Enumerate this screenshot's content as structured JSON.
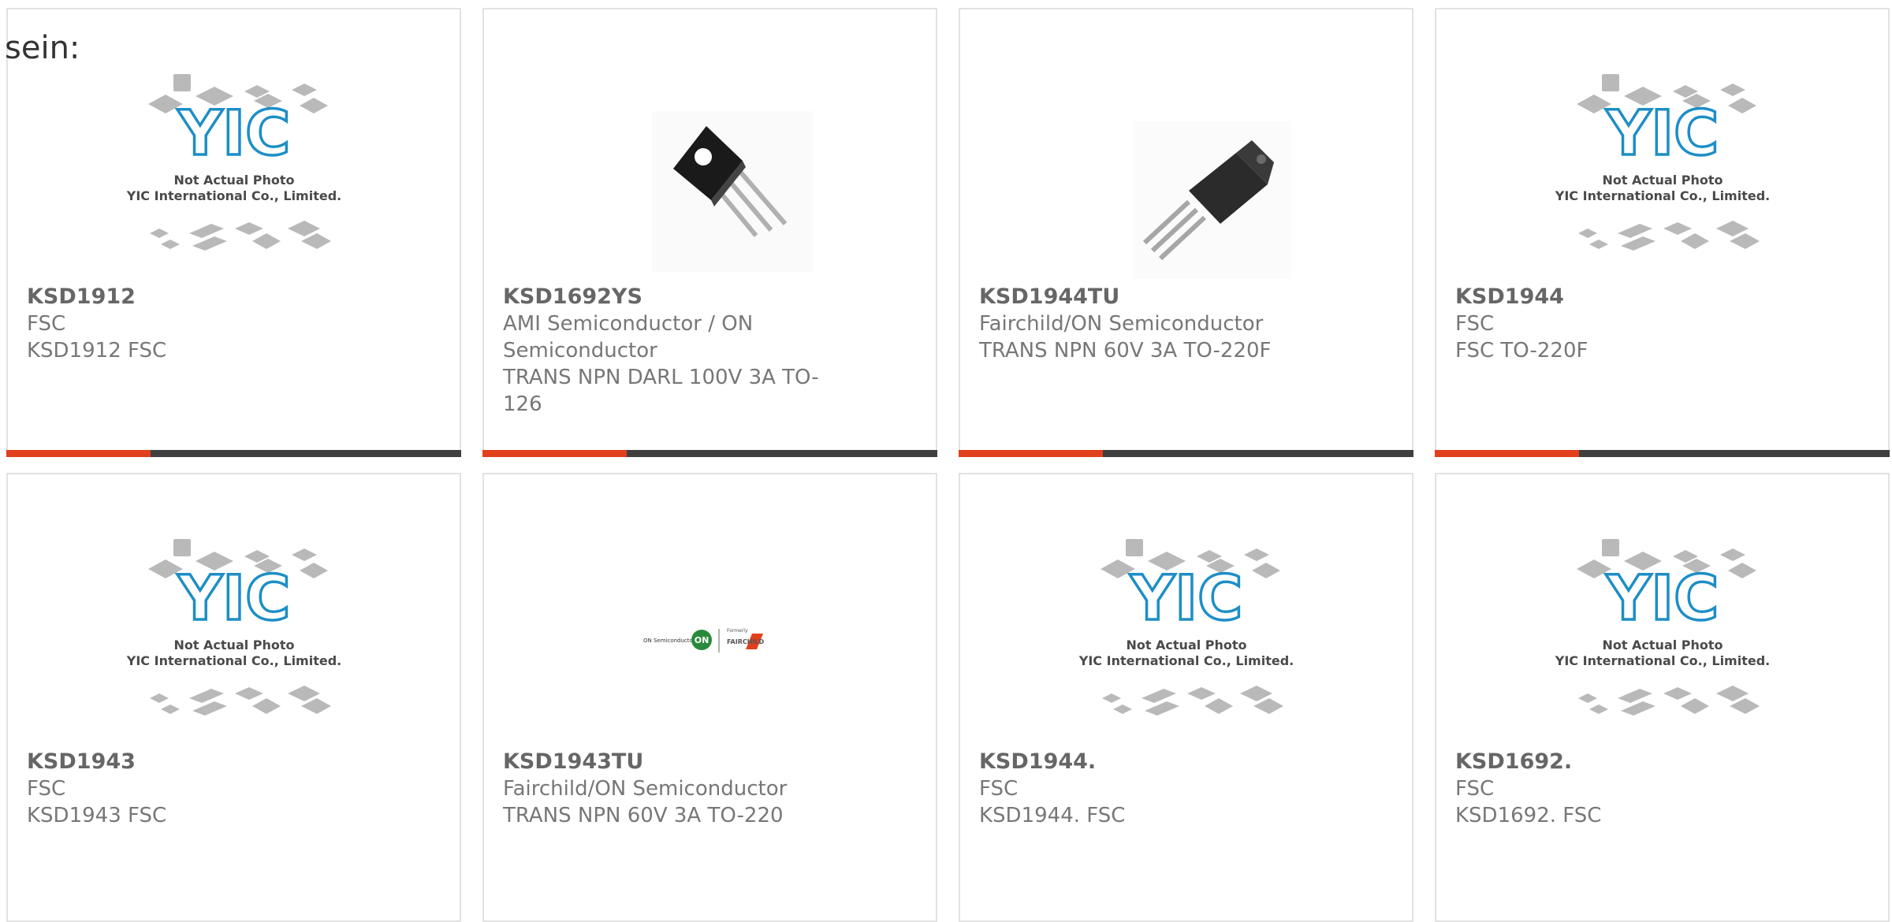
{
  "intro_text": "sein:",
  "placeholder_image": {
    "caption_line1": "Not Actual Photo",
    "caption_line2": "YIC International Co., Limited.",
    "logo_text": "YIC",
    "logo_color": "#1d8ec7"
  },
  "brand_logos": {
    "on_semi_text": "ON Semiconductor",
    "on_mark": "ON",
    "formerly_text": "Formerly",
    "fairchild_text": "FAIRCHILD"
  },
  "colors": {
    "accent_bar": "#e2401c",
    "dark_bar": "#3f3f3f",
    "card_border": "#e2e2e2"
  },
  "products": [
    {
      "part": "KSD1912",
      "manufacturer": "FSC",
      "description": "KSD1912 FSC",
      "image": "yic-placeholder",
      "bar": true
    },
    {
      "part": "KSD1692YS",
      "manufacturer": "AMI Semiconductor / ON Semiconductor",
      "description": "TRANS NPN DARL 100V 3A TO-126",
      "image": "to126-transistor-photo",
      "bar": true
    },
    {
      "part": "KSD1944TU",
      "manufacturer": "Fairchild/ON Semiconductor",
      "description": "TRANS NPN 60V 3A TO-220F",
      "image": "to220f-transistor-photo",
      "bar": true
    },
    {
      "part": "KSD1944",
      "manufacturer": "FSC",
      "description": "FSC TO-220F",
      "image": "yic-placeholder",
      "bar": true
    },
    {
      "part": "KSD1943",
      "manufacturer": "FSC",
      "description": "KSD1943 FSC",
      "image": "yic-placeholder",
      "bar": false
    },
    {
      "part": "KSD1943TU",
      "manufacturer": "Fairchild/ON Semiconductor",
      "description": "TRANS NPN 60V 3A TO-220",
      "image": "on-fairchild-logo",
      "bar": false
    },
    {
      "part": "KSD1944.",
      "manufacturer": "FSC",
      "description": "KSD1944. FSC",
      "image": "yic-placeholder",
      "bar": false
    },
    {
      "part": "KSD1692.",
      "manufacturer": "FSC",
      "description": "KSD1692. FSC",
      "image": "yic-placeholder",
      "bar": false
    }
  ]
}
